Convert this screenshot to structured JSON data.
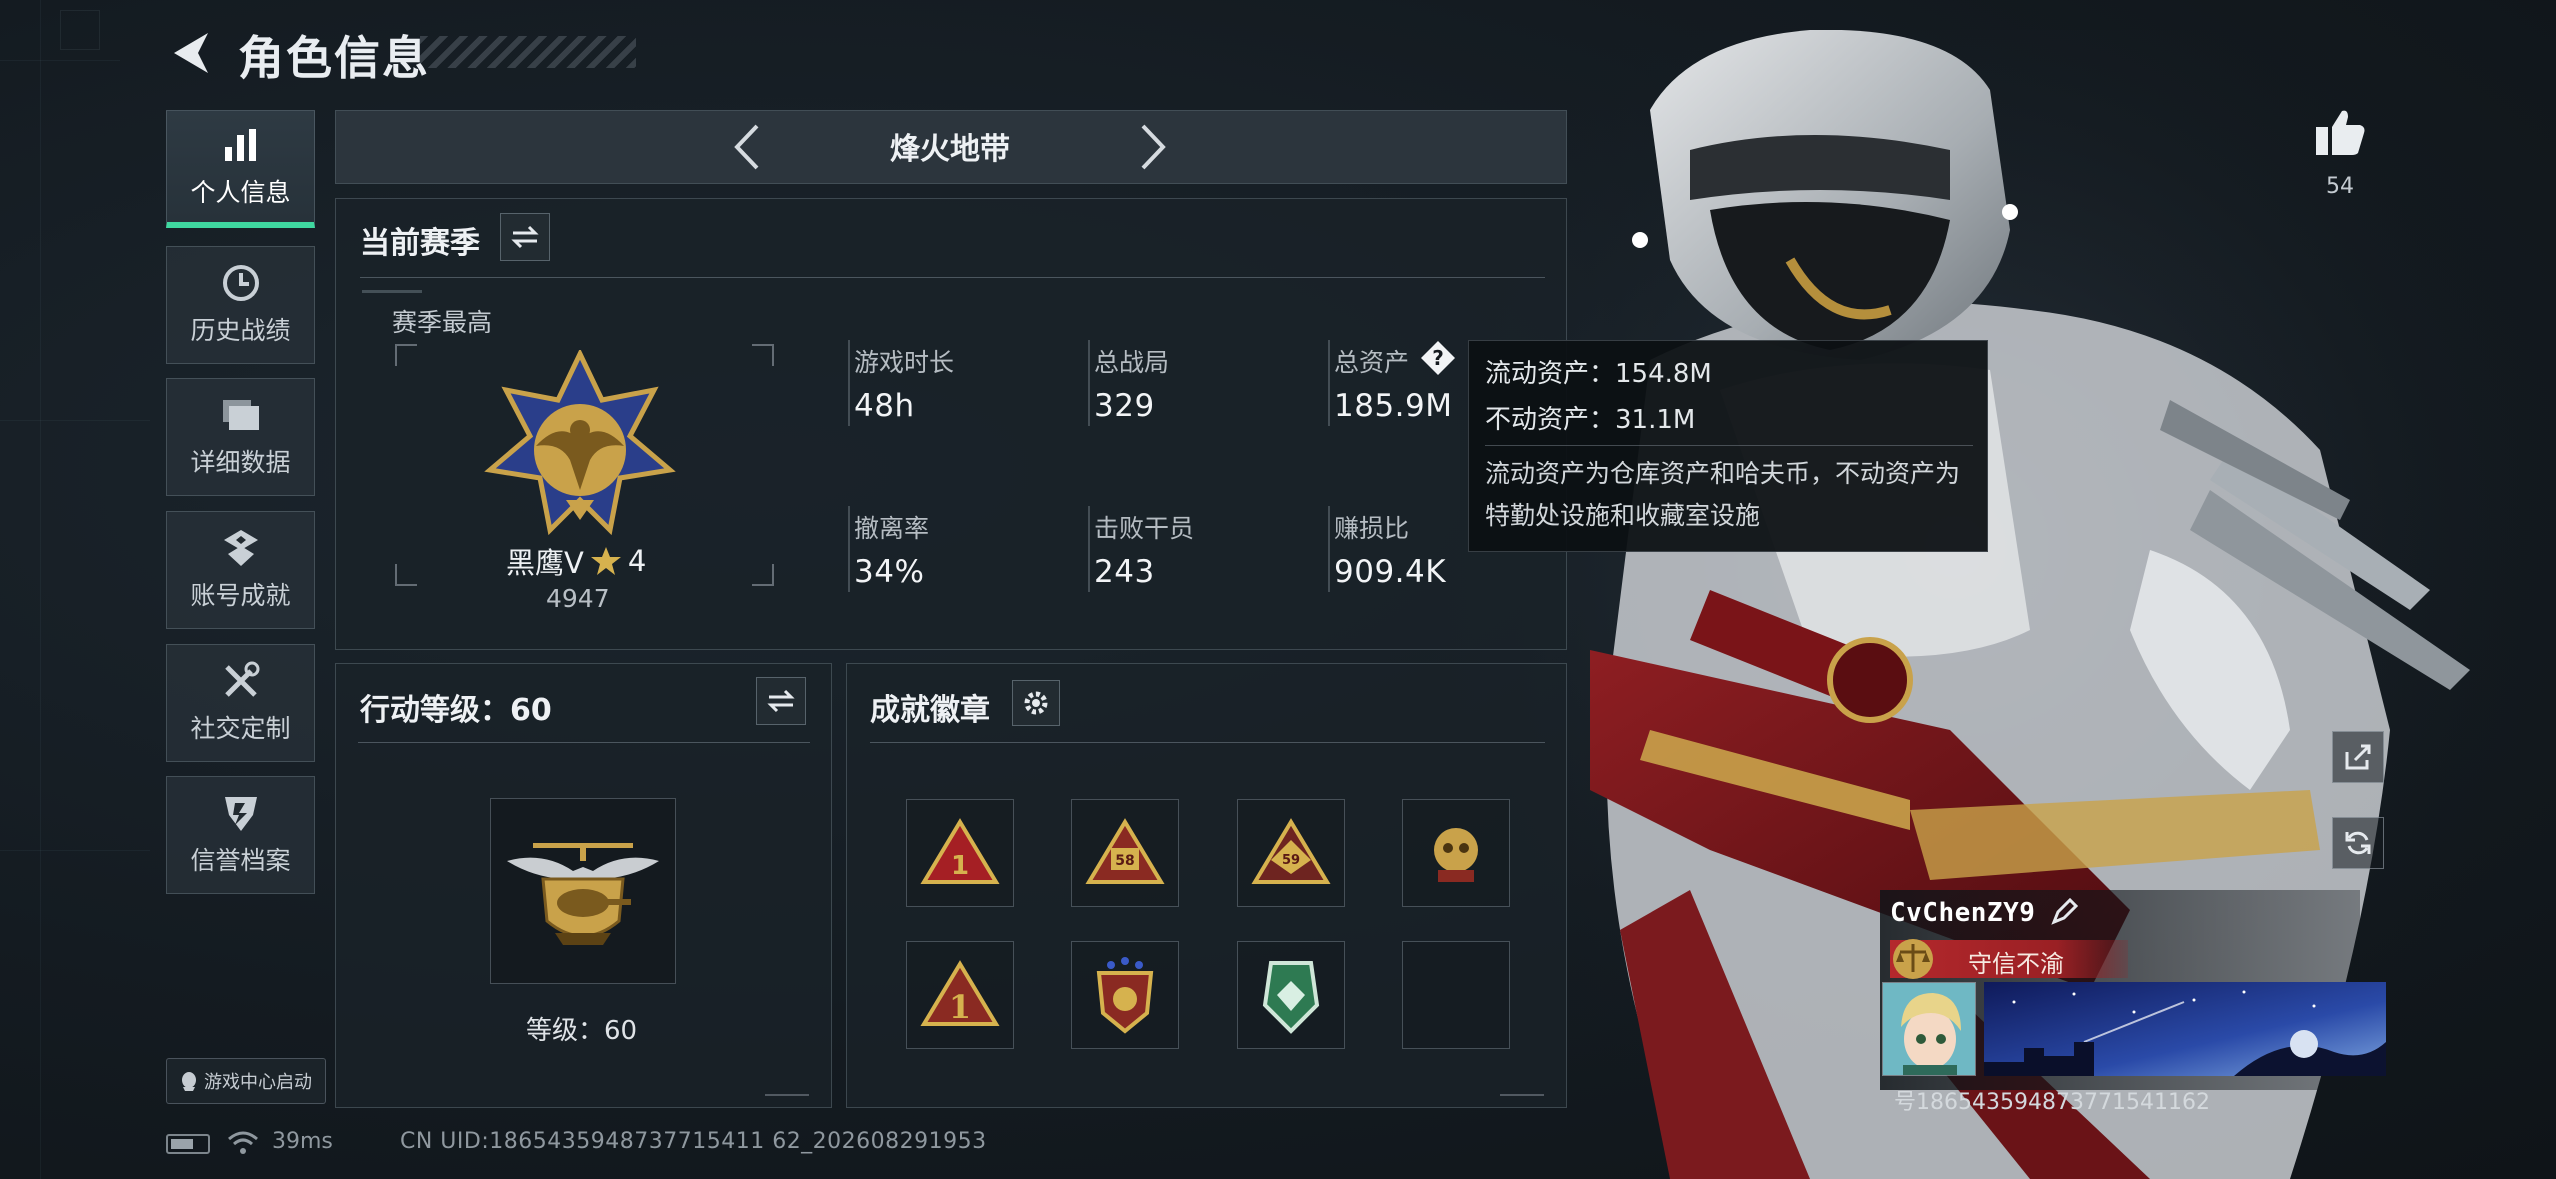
{
  "header": {
    "title": "角色信息",
    "back_icon": "back-arrow-icon"
  },
  "nav": {
    "items": [
      {
        "label": "个人信息",
        "icon": "bar-chart-icon",
        "active": true
      },
      {
        "label": "历史战绩",
        "icon": "clock-icon",
        "active": false
      },
      {
        "label": "详细数据",
        "icon": "folder-icon",
        "active": false
      },
      {
        "label": "账号成就",
        "icon": "medal-icon",
        "active": false
      },
      {
        "label": "社交定制",
        "icon": "tools-icon",
        "active": false
      },
      {
        "label": "信誉档案",
        "icon": "shield-icon",
        "active": false
      }
    ],
    "game_center_label": "游戏中心启动"
  },
  "footer": {
    "ping": "39ms",
    "uid": "CN UID:1865435948737715411 62_202608291953"
  },
  "mode": {
    "name": "烽火地带"
  },
  "season": {
    "title": "当前赛季",
    "best_label": "赛季最高",
    "rank_name": "黑鹰V",
    "rank_stars": "4",
    "rank_score": "4947",
    "stats": [
      {
        "label": "游戏时长",
        "value": "48h"
      },
      {
        "label": "总战局",
        "value": "329"
      },
      {
        "label": "总资产",
        "value": "185.9M"
      },
      {
        "label": "撤离率",
        "value": "34%"
      },
      {
        "label": "击败干员",
        "value": "243"
      },
      {
        "label": "赚损比",
        "value": "909.4K"
      }
    ],
    "tooltip": {
      "liquid": "流动资产：154.8M",
      "fixed": "不动资产：31.1M",
      "desc": "流动资产为仓库资产和哈夫币，不动资产为特勤处设施和收藏室设施"
    }
  },
  "action_level": {
    "title": "行动等级：60",
    "level_label": "等级：60"
  },
  "badges": {
    "title": "成就徽章"
  },
  "profile": {
    "likes": "54",
    "name": "CvChenZY9",
    "title_badge": "守信不渝",
    "id_line": "号186543594873771541162"
  },
  "colors": {
    "accent": "#3fd8a0",
    "title_red": "#b4282c",
    "gold": "#c9a24a"
  }
}
